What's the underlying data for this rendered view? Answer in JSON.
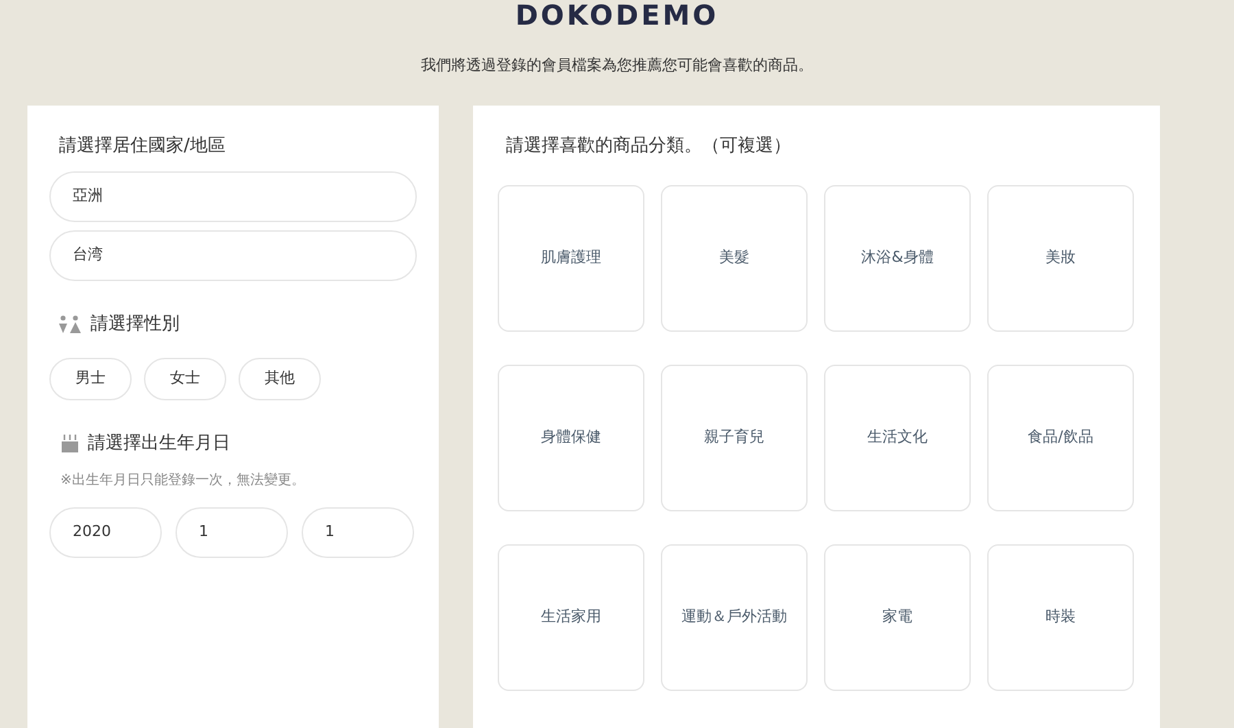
{
  "logo": "DOKODEMO",
  "intro": "我們將透過登錄的會員檔案為您推薦您可能會喜歡的商品。",
  "region": {
    "title": "請選擇居住國家/地區",
    "fields": [
      "亞洲",
      "台湾"
    ]
  },
  "gender": {
    "title": "請選擇性別",
    "options": [
      "男士",
      "女士",
      "其他"
    ]
  },
  "birthday": {
    "title": "請選擇出生年月日",
    "note": "※出生年月日只能登錄一次，無法變更。",
    "fields": [
      "2020",
      "1",
      "1"
    ]
  },
  "categories": {
    "title": "請選擇喜歡的商品分類。（可複選）",
    "items": [
      "肌膚護理",
      "美髮",
      "沐浴&身體",
      "美妝",
      "身體保健",
      "親子育兒",
      "生活文化",
      "食品/飲品",
      "生活家用",
      "運動＆戶外活動",
      "家電",
      "時裝"
    ]
  }
}
